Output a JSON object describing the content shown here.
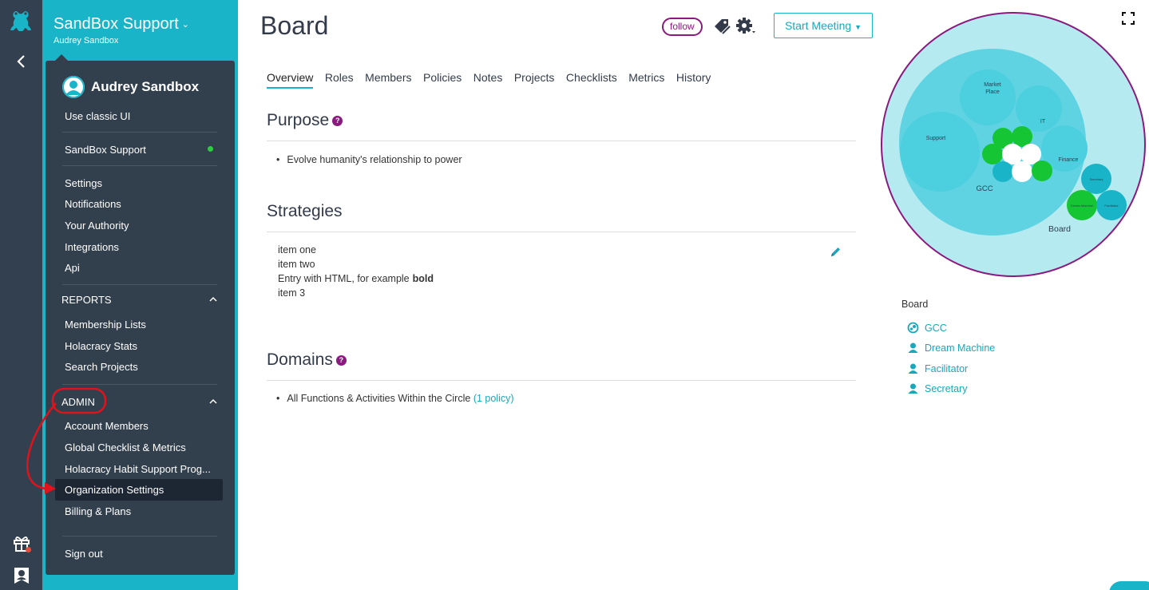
{
  "org": {
    "name": "SandBox Support",
    "user": "Audrey Sandbox"
  },
  "menu": {
    "user_name": "Audrey Sandbox",
    "classic_ui": "Use classic UI",
    "org_item": "SandBox Support",
    "settings_items": [
      "Settings",
      "Notifications",
      "Your Authority",
      "Integrations",
      "Api"
    ],
    "reports_label": "REPORTS",
    "reports_items": [
      "Membership Lists",
      "Holacracy Stats",
      "Search Projects"
    ],
    "admin_label": "ADMIN",
    "admin_items": [
      "Account Members",
      "Global Checklist & Metrics",
      "Holacracy Habit Support Prog...",
      "Organization Settings",
      "Billing & Plans"
    ],
    "sign_out": "Sign out"
  },
  "page": {
    "title": "Board",
    "follow_label": "follow",
    "start_meeting": "Start Meeting",
    "tabs": [
      "Overview",
      "Roles",
      "Members",
      "Policies",
      "Notes",
      "Projects",
      "Checklists",
      "Metrics",
      "History"
    ],
    "active_tab": "Overview",
    "purpose_title": "Purpose",
    "purpose_items": [
      "Evolve humanity's relationship to power"
    ],
    "strategies_title": "Strategies",
    "strategies": [
      "item one",
      "item two",
      "Entry with HTML, for example",
      "item 3"
    ],
    "strategies_bold": "bold",
    "domains_title": "Domains",
    "domain_text": "All Functions & Activities Within the Circle",
    "domain_link": "(1 policy)",
    "help_glyph": "?"
  },
  "circle_map": {
    "outer": "Board",
    "inner": "GCC",
    "labels": [
      "Market Place",
      "IT",
      "Support",
      "Finance",
      "Secretary",
      "Dream Machine",
      "Facilitator"
    ]
  },
  "right_panel": {
    "title": "Board",
    "items": [
      {
        "label": "GCC",
        "icon": "circle-icon"
      },
      {
        "label": "Dream Machine",
        "icon": "person-icon"
      },
      {
        "label": "Facilitator",
        "icon": "person-icon"
      },
      {
        "label": "Secretary",
        "icon": "person-icon"
      }
    ]
  },
  "colors": {
    "teal": "#1ab4c8",
    "navy": "#323f4d",
    "purple": "#8a1a7e",
    "green": "#16c533",
    "annotation_red": "#e0121a"
  }
}
